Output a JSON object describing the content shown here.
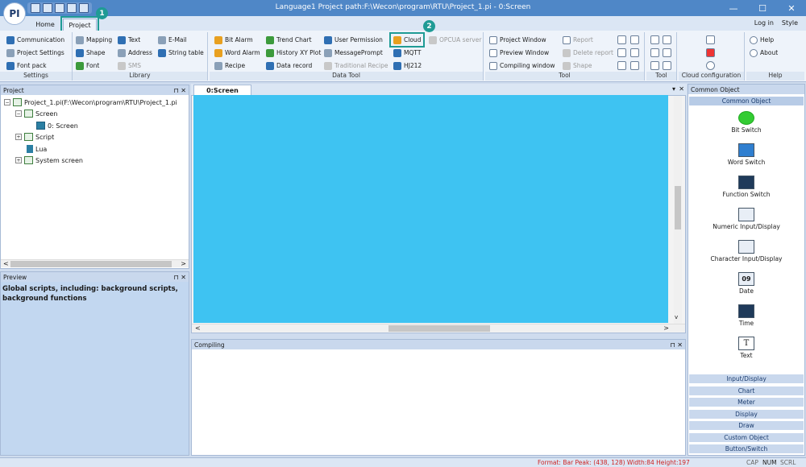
{
  "window": {
    "title": "Language1    Project path:F:\\Wecon\\program\\RTU\\Project_1.pi    - 0:Screen",
    "logo": "PI",
    "minimize": "—",
    "maximize": "☐",
    "close": "✕"
  },
  "menu_tabs": [
    {
      "label": "Home"
    },
    {
      "label": "Project"
    }
  ],
  "markers": {
    "one": "1",
    "two": "2"
  },
  "top_right": {
    "login": "Log in",
    "style": "Style"
  },
  "ribbon": {
    "settings": {
      "caption": "Settings",
      "items": [
        "Communication",
        "Project Settings",
        "Font pack"
      ]
    },
    "library": {
      "caption": "Library",
      "items": [
        "Mapping",
        "Shape",
        "Font",
        "Text",
        "Address",
        "SMS",
        "E-Mail",
        "String table"
      ]
    },
    "data_tool": {
      "caption": "Data Tool",
      "items": [
        "Bit Alarm",
        "Word Alarm",
        "Recipe",
        "Trend Chart",
        "History XY Plot",
        "Data record",
        "User Permission",
        "MessagePrompt",
        "Traditional Recipe",
        "Cloud",
        "MQTT",
        "HJ212",
        "OPCUA server"
      ]
    },
    "tool": {
      "caption": "Tool",
      "items": [
        "Project Window",
        "Preview Window",
        "Compiling window",
        "Report",
        "Delete report",
        "Shape"
      ]
    },
    "tool2": {
      "caption": "Tool"
    },
    "cloud_config": {
      "caption": "Cloud configuration"
    },
    "help": {
      "caption": "Help",
      "items": [
        "Help",
        "About"
      ]
    }
  },
  "project_panel": {
    "title": "Project",
    "pin": "⊓",
    "close": "✕",
    "tree": [
      {
        "label": "Project_1.pi(F:\\Wecon\\program\\RTU\\Project_1.pi"
      },
      {
        "label": "Screen"
      },
      {
        "label": "0: Screen"
      },
      {
        "label": "Script"
      },
      {
        "label": "Lua"
      },
      {
        "label": "System screen"
      }
    ],
    "expand": "−",
    "collapse": "+"
  },
  "preview_panel": {
    "title": "Preview",
    "pin": "⊓",
    "close": "✕",
    "text": "Global scripts, including: background scripts, background functions"
  },
  "doc": {
    "tab": "0:Screen",
    "down": "▾",
    "close": "✕"
  },
  "compiling_panel": {
    "title": "Compiling",
    "pin": "⊓",
    "close": "✕"
  },
  "common_object": {
    "title": "Common Object",
    "header": "Common Object",
    "items": [
      "Bit Switch",
      "Word Switch",
      "Function Switch",
      "Numeric Input/Display",
      "Character Input/Display",
      "Date",
      "Time",
      "Text"
    ],
    "date_icon": "09",
    "text_icon": "T",
    "categories": [
      "Input/Display",
      "Chart",
      "Meter",
      "Display",
      "Draw",
      "Custom Object",
      "Button/Switch"
    ]
  },
  "status_bar": {
    "info": "Format: Bar Peak: (438, 128) Width:84 Height:197",
    "cap": "CAP",
    "num": "NUM",
    "scrl": "SCRL"
  },
  "scroll": {
    "left": "<",
    "right": ">",
    "up": "^",
    "down": "v"
  },
  "colors": {
    "canvas": "#3ec3f2",
    "highlight": "#1f9b95",
    "titlebar": "#4f87c7"
  }
}
